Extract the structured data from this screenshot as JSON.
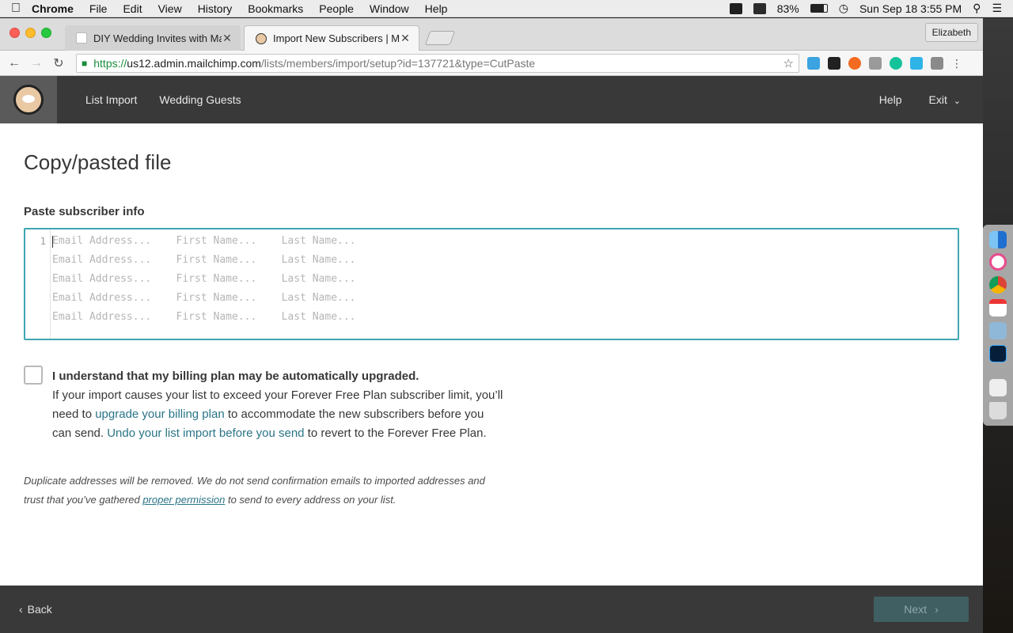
{
  "menubar": {
    "app": "Chrome",
    "menus": [
      "File",
      "Edit",
      "View",
      "History",
      "Bookmarks",
      "People",
      "Window",
      "Help"
    ],
    "battery": "83%",
    "datetime": "Sun Sep 18  3:55 PM"
  },
  "browser": {
    "tabs": [
      {
        "title": "DIY Wedding Invites with Mailc",
        "active": false
      },
      {
        "title": "Import New Subscribers | Mailc",
        "active": true
      }
    ],
    "profile": "Elizabeth",
    "url": {
      "scheme": "https://",
      "host": "us12.admin.mailchimp.com",
      "path": "/lists/members/import/setup?id=137721&type=CutPaste"
    }
  },
  "header": {
    "nav": [
      "List Import",
      "Wedding Guests"
    ],
    "help": "Help",
    "exit": "Exit"
  },
  "page": {
    "title": "Copy/pasted file",
    "paste_label": "Paste subscriber info",
    "line_number": "1",
    "placeholder_lines": [
      "Email Address...    First Name...    Last Name...",
      "Email Address...    First Name...    Last Name...",
      "Email Address...    First Name...    Last Name...",
      "Email Address...    First Name...    Last Name...",
      "Email Address...    First Name...    Last Name..."
    ],
    "billing": {
      "heading": "I understand that my billing plan may be automatically upgraded.",
      "text_1": "If your import causes your list to exceed your Forever Free Plan subscriber limit, you’ll need to ",
      "link_1": "upgrade your billing plan",
      "text_2": " to accommodate the new subscribers before you can send. ",
      "link_2": "Undo your list import before you send",
      "text_3": " to revert to the Forever Free Plan."
    },
    "notice": {
      "text_1": "Duplicate addresses will be removed. We do not send confirmation emails to imported addresses and trust that you’ve gathered ",
      "link": "proper permission",
      "text_2": " to send to every address on your list."
    }
  },
  "footer": {
    "back": "Back",
    "next": "Next"
  }
}
